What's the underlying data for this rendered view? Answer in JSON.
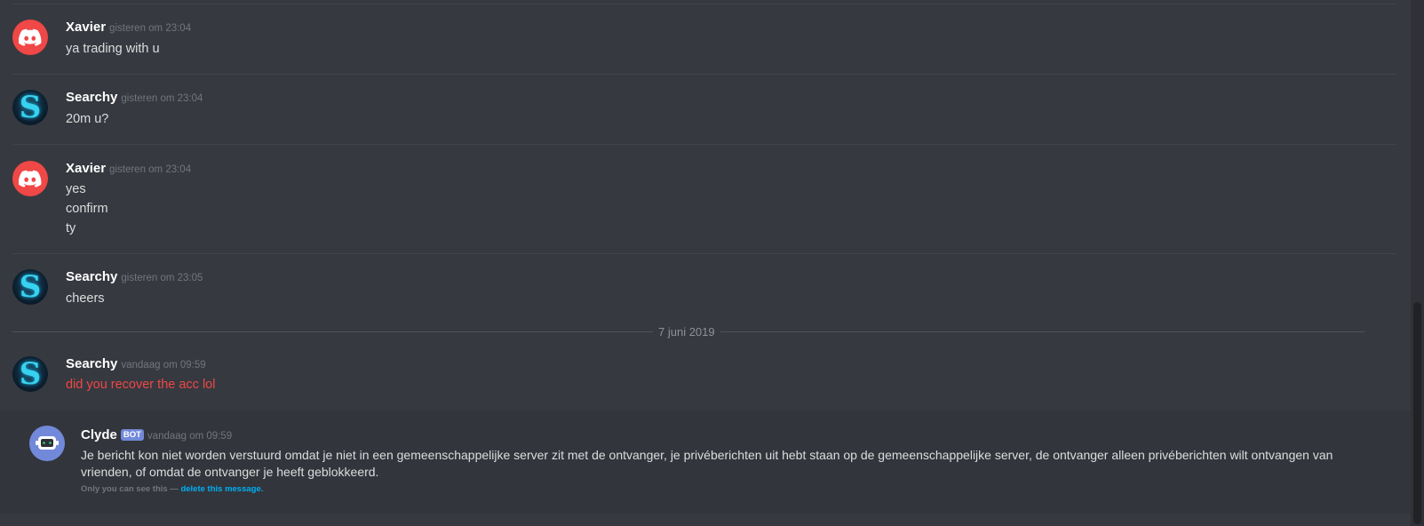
{
  "messages": [
    {
      "author": "Xavier",
      "timestamp": "gisteren om 23:04",
      "avatar": "discord-logo-icon",
      "lines": [
        "ya trading with u"
      ]
    },
    {
      "author": "Searchy",
      "timestamp": "gisteren om 23:04",
      "avatar": "searchy-s-avatar",
      "lines": [
        "20m u?"
      ]
    },
    {
      "author": "Xavier",
      "timestamp": "gisteren om 23:04",
      "avatar": "discord-logo-icon",
      "lines": [
        "yes",
        "confirm",
        "ty"
      ]
    },
    {
      "author": "Searchy",
      "timestamp": "gisteren om 23:05",
      "avatar": "searchy-s-avatar",
      "lines": [
        "cheers"
      ]
    },
    {
      "author": "Searchy",
      "timestamp": "vandaag om 09:59",
      "avatar": "searchy-s-avatar",
      "lines": [
        "did you recover the acc lol"
      ],
      "failed": true
    }
  ],
  "date_separator": "7 juni 2019",
  "clyde": {
    "author": "Clyde",
    "badge": "BOT",
    "timestamp": "vandaag om 09:59",
    "text": "Je bericht kon niet worden verstuurd omdat je niet in een gemeenschappelijke server zit met de ontvanger, je privéberichten uit hebt staan op de gemeenschappelijke server, de ontvanger alleen privéberichten wilt ontvangen van vrienden, of omdat de ontvanger je heeft geblokkeerd.",
    "note_prefix": "Only you can see this —",
    "note_link": "delete this message."
  },
  "colors": {
    "background": "#36393f",
    "discord_red": "#f04747",
    "blurple": "#7289da",
    "link": "#00b0f4",
    "searchy_cyan": "#37d2f0"
  }
}
